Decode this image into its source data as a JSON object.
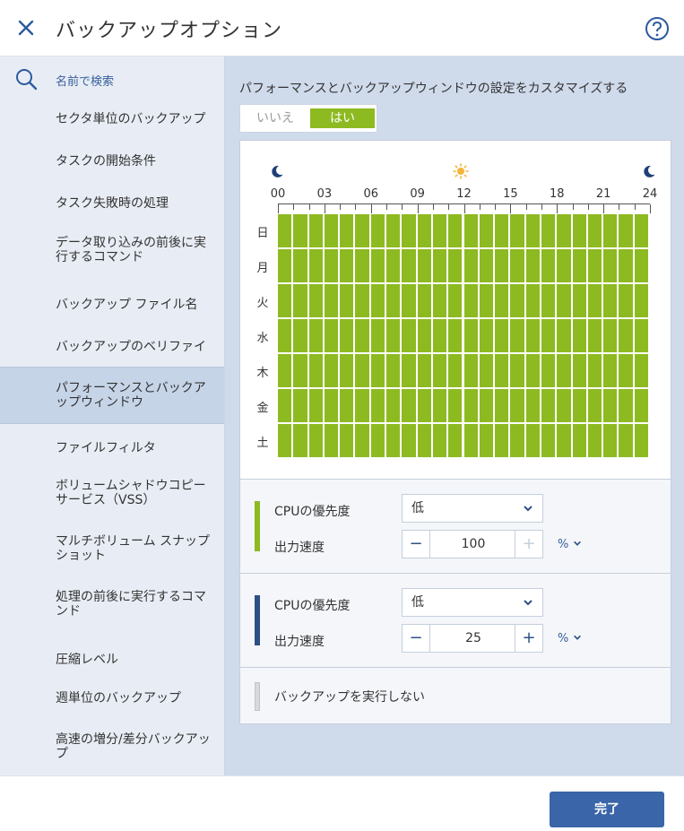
{
  "header": {
    "title": "バックアップオプション",
    "close_icon": "close-icon",
    "help_icon": "help-icon"
  },
  "sidebar": {
    "search_placeholder": "名前で検索",
    "items": [
      {
        "label": "セクタ単位のバックアップ"
      },
      {
        "label": "タスクの開始条件"
      },
      {
        "label": "タスク失敗時の処理"
      },
      {
        "label": "データ取り込みの前後に実行するコマンド"
      },
      {
        "label": "バックアップ ファイル名"
      },
      {
        "label": "バックアップのベリファイ"
      },
      {
        "label": "パフォーマンスとバックアップウィンドウ",
        "active": true
      },
      {
        "label": "ファイルフィルタ"
      },
      {
        "label": "ボリュームシャドウコピーサービス（VSS）"
      },
      {
        "label": "マルチボリューム スナップショット"
      },
      {
        "label": "処理の前後に実行するコマンド"
      },
      {
        "label": "圧縮レベル"
      },
      {
        "label": "週単位のバックアップ"
      },
      {
        "label": "高速の増分/差分バックアップ"
      }
    ]
  },
  "main": {
    "description": "パフォーマンスとバックアップウィンドウの設定をカスタマイズする",
    "toggle": {
      "no": "いいえ",
      "yes": "はい",
      "selected": "はい"
    },
    "schedule": {
      "hours": [
        "00",
        "03",
        "06",
        "09",
        "12",
        "15",
        "18",
        "21",
        "24"
      ],
      "days": [
        "日",
        "月",
        "火",
        "水",
        "木",
        "金",
        "土"
      ],
      "slots_per_day": 24,
      "icons": [
        "moon-icon",
        "sun-icon",
        "moon-icon"
      ],
      "fill_color": "#8dba21"
    },
    "profiles": [
      {
        "color": "#8dba21",
        "cpu_label": "CPUの優先度",
        "cpu_value": "低",
        "output_label": "出力速度",
        "output_value": "100",
        "unit": "%",
        "minus": "−",
        "plus": "+"
      },
      {
        "color": "#2c4f86",
        "cpu_label": "CPUの優先度",
        "cpu_value": "低",
        "output_label": "出力速度",
        "output_value": "25",
        "unit": "%",
        "minus": "−",
        "plus": "+"
      }
    ],
    "no_backup": {
      "label": "バックアップを実行しない",
      "color": "#d6d9de"
    }
  },
  "footer": {
    "done_label": "完了"
  }
}
